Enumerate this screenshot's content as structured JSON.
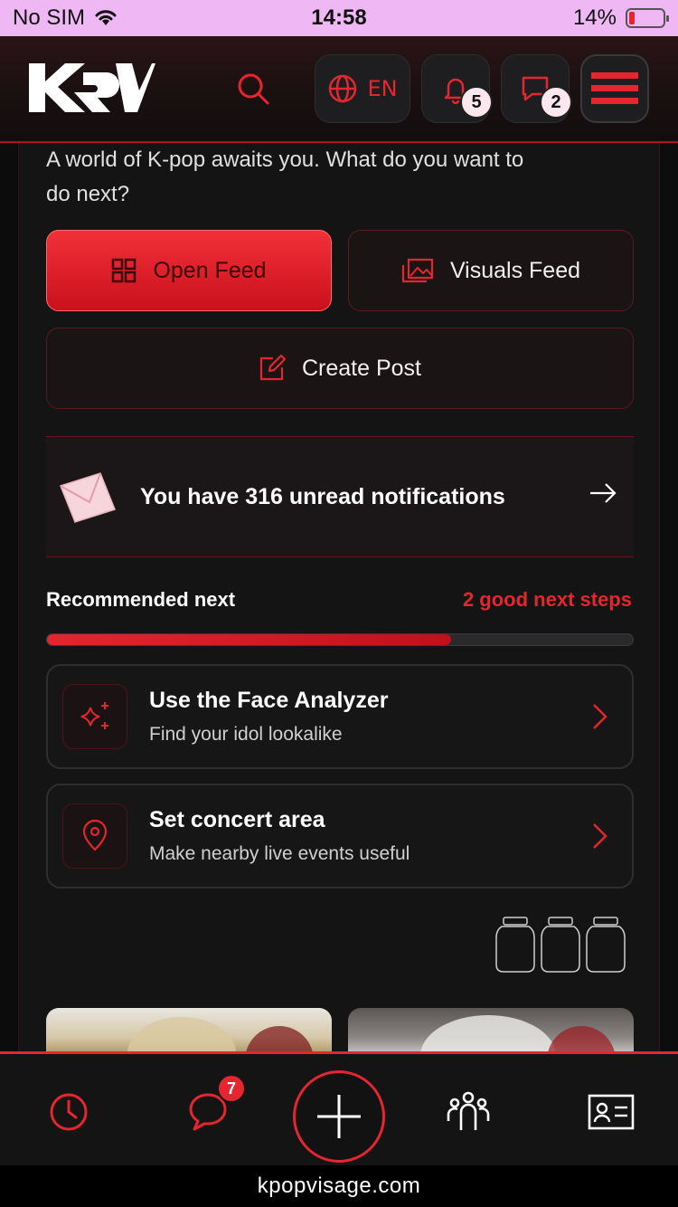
{
  "status_bar": {
    "carrier": "No SIM",
    "time": "14:58",
    "battery": "14%"
  },
  "header": {
    "logo_text": "KV",
    "language": "EN",
    "notifications_count": "5",
    "messages_count": "2"
  },
  "intro_text": "A world of K-pop awaits you. What do you want to do next?",
  "actions": {
    "open_feed": "Open Feed",
    "visuals_feed": "Visuals Feed",
    "create_post": "Create Post"
  },
  "notification_banner": {
    "text": "You have 316 unread notifications"
  },
  "recommended": {
    "title": "Recommended next",
    "count_label": "2 good next steps",
    "progress": 0.69,
    "steps": [
      {
        "title": "Use the Face Analyzer",
        "subtitle": "Find your idol lookalike"
      },
      {
        "title": "Set concert area",
        "subtitle": "Make nearby live events useful"
      }
    ]
  },
  "bottom_nav": {
    "chat_badge": "7"
  },
  "url": "kpopvisage.com",
  "colors": {
    "accent": "#e3262f",
    "background": "#141415",
    "status_bar": "#efb7f3"
  }
}
